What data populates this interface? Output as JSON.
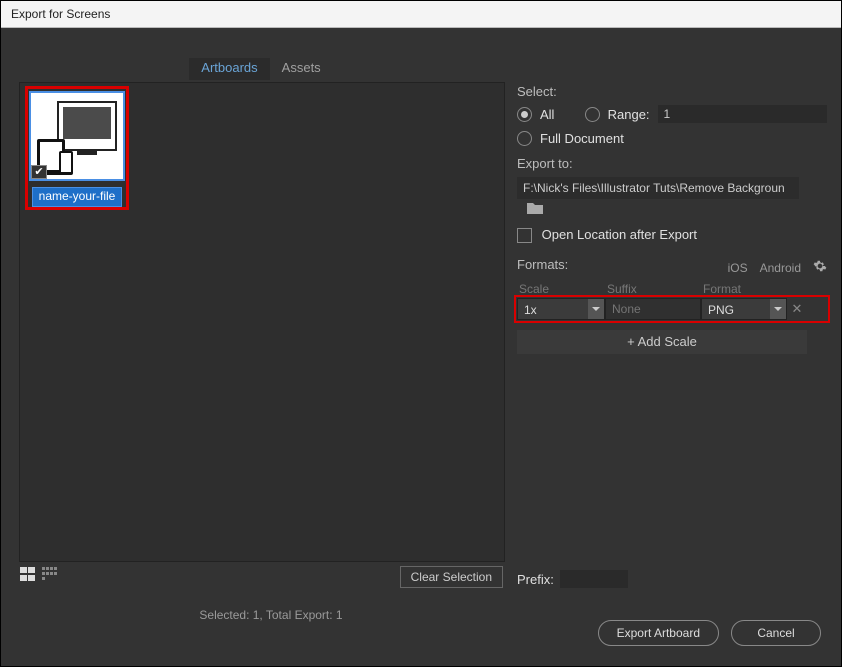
{
  "title": "Export for Screens",
  "tabs": {
    "artboards": "Artboards",
    "assets": "Assets"
  },
  "artboard": {
    "name": "name-your-file",
    "checked": true
  },
  "buttons": {
    "clear_selection": "Clear Selection",
    "export": "Export Artboard",
    "cancel": "Cancel",
    "add_scale": "+  Add Scale"
  },
  "select": {
    "label": "Select:",
    "all": "All",
    "range": "Range:",
    "range_value": "1",
    "full_doc": "Full Document"
  },
  "export_to": {
    "label": "Export to:",
    "path": "F:\\Nick's Files\\Illustrator Tuts\\Remove Backgroun",
    "open_after": "Open Location after Export"
  },
  "formats": {
    "label": "Formats:",
    "ios": "iOS",
    "android": "Android",
    "cols": {
      "scale": "Scale",
      "suffix": "Suffix",
      "format": "Format"
    },
    "row": {
      "scale": "1x",
      "suffix_placeholder": "None",
      "format": "PNG"
    }
  },
  "prefix": {
    "label": "Prefix:",
    "value": ""
  },
  "status": "Selected: 1, Total Export: 1"
}
